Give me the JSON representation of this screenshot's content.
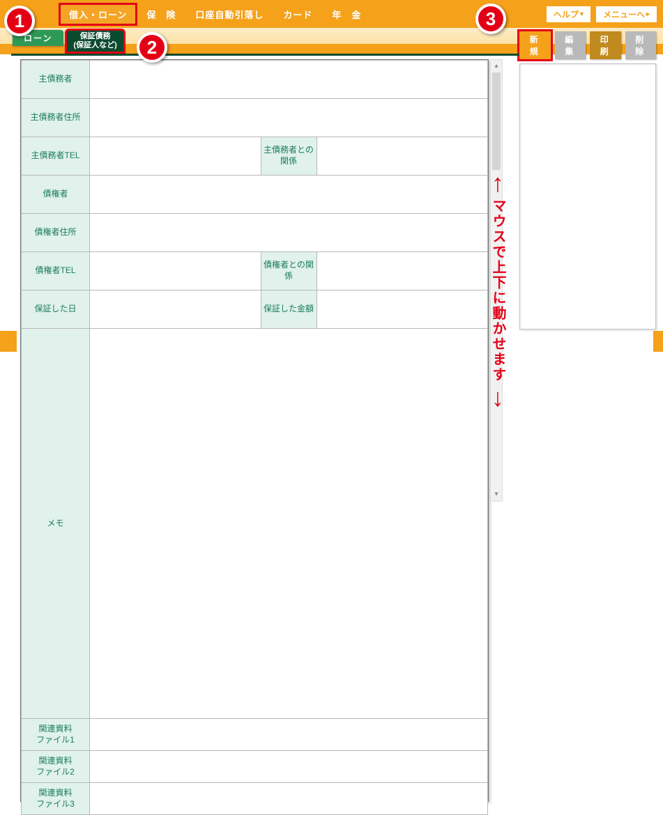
{
  "nav": {
    "items": [
      "借入・ローン",
      "保　険",
      "口座自動引落し",
      "カード",
      "年　金"
    ],
    "help": "ヘルプ",
    "menu": "メニューへ"
  },
  "subtabs": {
    "loan": "ローン",
    "guarantee_line1": "保証債務",
    "guarantee_line2": "(保証人など)"
  },
  "actions": {
    "new": "新 規",
    "edit": "編 集",
    "print": "印 刷",
    "delete": "削 除"
  },
  "form": {
    "main_debtor": "主債務者",
    "main_debtor_addr": "主債務者住所",
    "main_debtor_tel": "主債務者TEL",
    "main_debtor_rel": "主債務者との関係",
    "creditor": "債権者",
    "creditor_addr": "債権者住所",
    "creditor_tel": "債権者TEL",
    "creditor_rel": "債権者との関係",
    "guarantee_date": "保証した日",
    "guarantee_amount": "保証した金額",
    "memo": "メモ",
    "file1_l1": "関連資料",
    "file1_l2": "ファイル1",
    "file2_l1": "関連資料",
    "file2_l2": "ファイル2",
    "file3_l1": "関連資料",
    "file3_l2": "ファイル3"
  },
  "hint": "マウスで上下に動かせます",
  "callouts": {
    "one": "1",
    "two": "2",
    "three": "3"
  }
}
